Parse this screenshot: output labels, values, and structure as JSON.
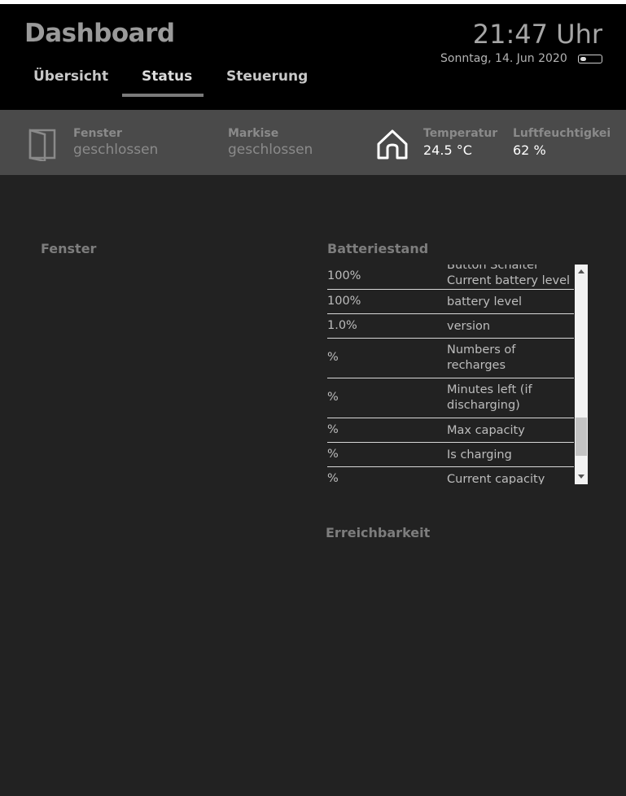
{
  "header": {
    "title": "Dashboard",
    "clock": "21:47 Uhr",
    "date": "Sonntag, 14. Jun 2020",
    "tabs": [
      {
        "label": "Übersicht"
      },
      {
        "label": "Status"
      },
      {
        "label": "Steuerung"
      }
    ],
    "active_tab": "Status"
  },
  "statusbar": {
    "fenster": {
      "label": "Fenster",
      "value": "geschlossen",
      "icon": "window-icon"
    },
    "markise": {
      "label": "Markise",
      "value": "geschlossen"
    },
    "temperatur": {
      "label": "Temperatur",
      "value": "24.5 °C",
      "icon": "house-icon"
    },
    "luftfeuchtigkeit": {
      "label": "Luftfeuchtigkei",
      "value": "62 %"
    }
  },
  "sections": {
    "fenster": "Fenster",
    "batteriestand": "Batteriestand",
    "erreichbarkeit": "Erreichbarkeit"
  },
  "battery_table": {
    "rows": [
      {
        "value": "100%",
        "label_line1": "Button Schalter",
        "label_line2": "Current battery level"
      },
      {
        "value": "100%",
        "label": "battery level"
      },
      {
        "value": "1.0%",
        "label": "version"
      },
      {
        "value": "%",
        "label_line1": "Numbers of",
        "label_line2": "recharges"
      },
      {
        "value": "%",
        "label_line1": "Minutes left (if",
        "label_line2": "discharging)"
      },
      {
        "value": "%",
        "label": "Max capacity"
      },
      {
        "value": "%",
        "label": "Is charging"
      },
      {
        "value": "%",
        "label": "Current capacity"
      }
    ]
  },
  "colors": {
    "background": "#222222",
    "header_bg": "#000000",
    "statusbar_bg": "#4a4a4a",
    "tab_indicator": "#7a7a7a"
  }
}
